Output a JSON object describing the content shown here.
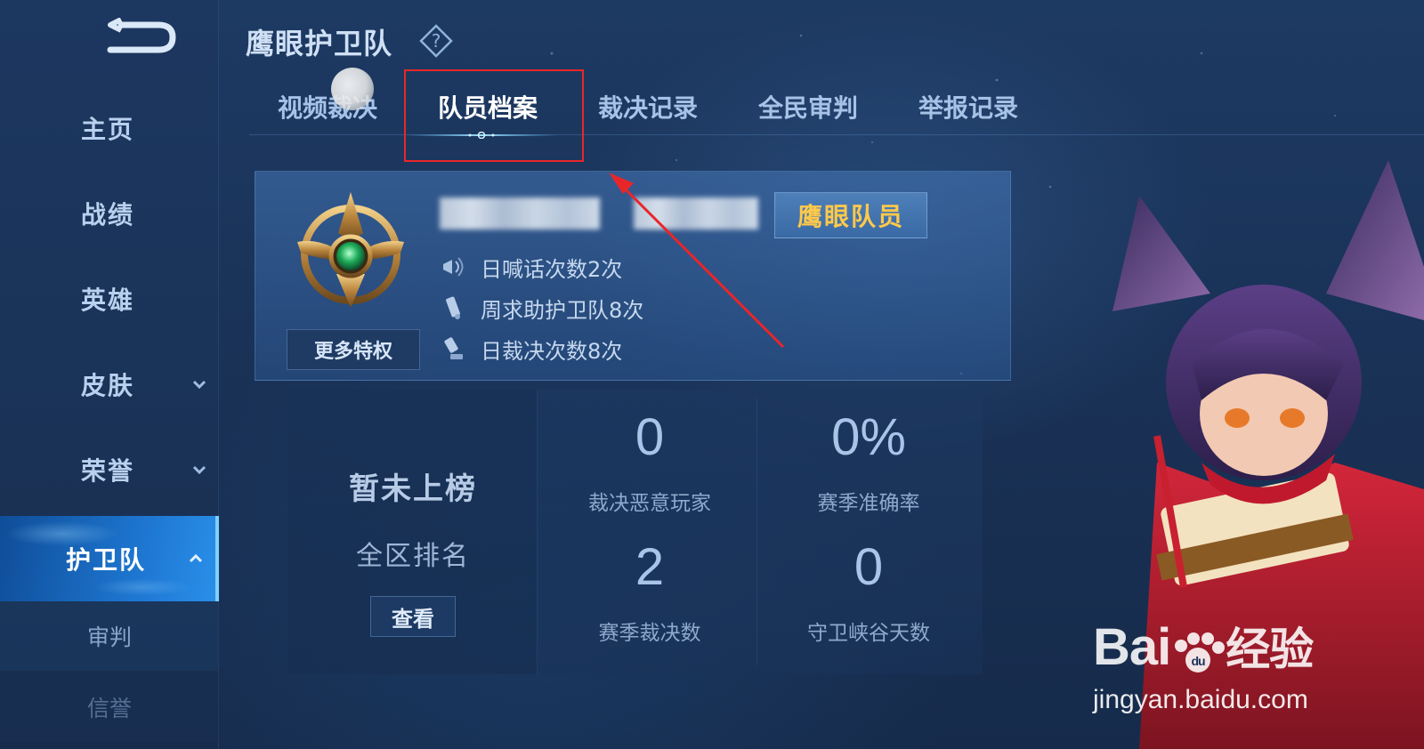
{
  "sidebar": {
    "items": [
      {
        "label": "主页"
      },
      {
        "label": "战绩"
      },
      {
        "label": "英雄"
      },
      {
        "label": "皮肤",
        "has_chevron": true
      },
      {
        "label": "荣誉",
        "has_chevron": true
      },
      {
        "label": "护卫队",
        "active": true,
        "expanded": true
      }
    ],
    "sub_items": [
      {
        "label": "审判"
      },
      {
        "label": "信誉"
      }
    ]
  },
  "header": {
    "title": "鹰眼护卫队",
    "help_icon": "question-diamond-icon"
  },
  "tabs": [
    {
      "label": "视频裁决"
    },
    {
      "label": "队员档案",
      "active": true
    },
    {
      "label": "裁决记录"
    },
    {
      "label": "全民审判"
    },
    {
      "label": "举报记录"
    }
  ],
  "profile": {
    "role_badge": "鹰眼队员",
    "more_button": "更多特权",
    "perks": [
      {
        "icon": "megaphone-icon",
        "text": "日喊话次数2次"
      },
      {
        "icon": "scroll-icon",
        "text": "周求助护卫队8次"
      },
      {
        "icon": "gavel-icon",
        "text": "日裁决次数8次"
      }
    ]
  },
  "ranking": {
    "status": "暂未上榜",
    "label": "全区排名",
    "view_button": "查看"
  },
  "stats": [
    {
      "value": "0",
      "label": "裁决恶意玩家"
    },
    {
      "value": "0%",
      "label": "赛季准确率"
    },
    {
      "value": "2",
      "label": "赛季裁决数"
    },
    {
      "value": "0",
      "label": "守卫峡谷天数"
    }
  ],
  "watermark": {
    "logo": "Bai",
    "logo_suffix": "经验",
    "url": "jingyan.baidu.com"
  },
  "colors": {
    "accent_active": "#1f7ad6",
    "badge_text": "#ffc94a",
    "highlight": "#e8262a"
  }
}
